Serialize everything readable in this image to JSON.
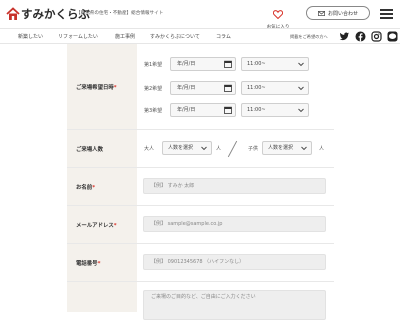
{
  "header": {
    "logo_text": "すみかくらぶ",
    "tagline": "【群馬県の住宅・不動産】総合情報サイト",
    "favorites_label": "お気に入り",
    "inquiry_label": "お問い合わせ"
  },
  "nav": {
    "items": [
      "新築したい",
      "リフォームしたい",
      "施工事例",
      "すみかくらぶについて",
      "コラム"
    ],
    "sns_label": "掲載をご希望の方へ"
  },
  "form": {
    "visit_date": {
      "label": "ご来場希望日時",
      "required_mark": "*",
      "choices": [
        {
          "label": "第1希望",
          "date_placeholder": "年/月/日",
          "time_value": "11:00~"
        },
        {
          "label": "第2希望",
          "date_placeholder": "年/月/日",
          "time_value": "11:00~"
        },
        {
          "label": "第3希望",
          "date_placeholder": "年/月/日",
          "time_value": "11:00~"
        }
      ]
    },
    "visitors": {
      "label": "ご来場人数",
      "adult_label": "大人",
      "child_label": "子供",
      "select_placeholder": "人数を選択",
      "unit": "人"
    },
    "name": {
      "label": "お名前",
      "required_mark": "*",
      "placeholder": "【例】 すみか 太郎"
    },
    "email": {
      "label": "メールアドレス",
      "required_mark": "*",
      "placeholder": "【例】 sample@sample.co.jp"
    },
    "phone": {
      "label": "電話番号",
      "required_mark": "*",
      "placeholder": "【例】 09012345678 （ハイフンなし）"
    },
    "message": {
      "placeholder": "ご来場のご目的など、ご自由にご入力ください"
    }
  },
  "colors": {
    "label_bg": "#f4f1ec",
    "required": "#d9342b",
    "logo_red": "#c8322b"
  }
}
